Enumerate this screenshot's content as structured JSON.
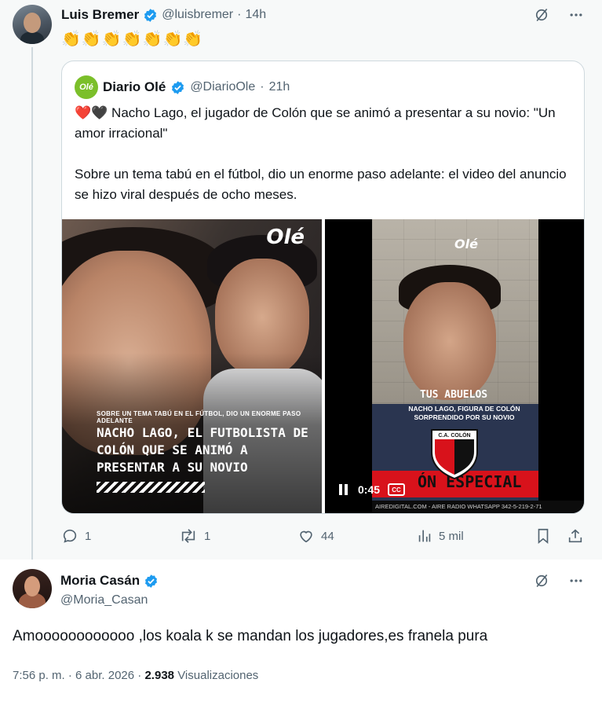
{
  "post1": {
    "name": "Luis Bremer",
    "handle": "@luisbremer",
    "dot": "·",
    "time": "14h",
    "emojis": "👏👏👏👏👏👏👏",
    "quote": {
      "name": "Diario Olé",
      "logo_text": "Olé",
      "handle": "@DiarioOle",
      "dot": "·",
      "time": "21h",
      "paragraph1": "❤️🖤 Nacho Lago, el jugador de Colón que se animó a presentar a su novio: \"Un amor irracional\"",
      "paragraph2": "Sobre un tema tabú en el fútbol, dio un enorme paso adelante: el video del anuncio se hizo viral después de ocho meses.",
      "image1": {
        "logo": "Olé",
        "small_caption": "SOBRE UN TEMA TABÚ EN EL FÚTBOL, DIO UN ENORME PASO ADELANTE",
        "big_caption": "NACHO LAGO, EL FUTBOLISTA DE COLÓN QUE SE ANIMÓ A PRESENTAR A SU NOVIO"
      },
      "video": {
        "logo": "Olé",
        "overlay_title": "TUS ABUELOS",
        "overlay_sub": "NACHO LAGO, FIGURA DE COLÓN SORPRENDIDO POR SU NOVIO",
        "shield_text": "C.A. COLÓN",
        "band_text": "ÓN ESPECIAL",
        "ticker": "AIREDIGITAL.COM - AIRE RADIO WHATSAPP 342-5-219-2-71",
        "elapsed": "0:45",
        "cc_label": "CC"
      }
    },
    "actions": {
      "replies": "1",
      "reposts": "1",
      "likes": "44",
      "views": "5 mil"
    }
  },
  "post2": {
    "name": "Moria Casán",
    "handle": "@Moria_Casan",
    "text": "Amoooooooooooo ,los koala k se mandan los jugadores,es franela pura",
    "time": "7:56 p. m.",
    "dot": "·",
    "date": "6 abr. 2026",
    "views_count": "2.938",
    "views_label": "Visualizaciones"
  },
  "colors": {
    "verified": "#1d9bf0",
    "muted": "#536471",
    "text": "#0f1419",
    "ole_green": "#7bbf2a",
    "colon_red": "#d8121b"
  },
  "icons": [
    "verified-badge-icon",
    "grok-icon",
    "more-icon",
    "reply-icon",
    "repost-icon",
    "like-icon",
    "views-icon",
    "bookmark-icon",
    "share-icon",
    "pause-icon",
    "captions-icon"
  ]
}
